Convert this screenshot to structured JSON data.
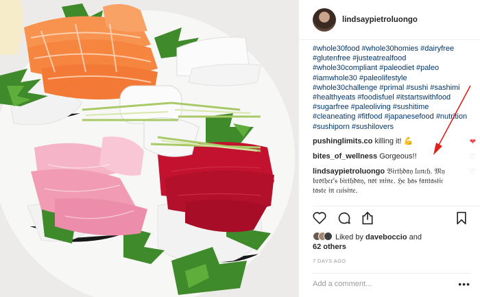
{
  "post": {
    "username": "lindsaypietroluongo",
    "caption": "#whole30food #whole30homies #dairyfree #glutenfree #justeatrealfood #whole30compliant #paleodiet #paleo #iamwhole30 #paleolifestyle #whole30challenge #primal #sushi #sashimi #healthyeats #foodisfuel #itstartswithfood #sugarfree #paleoliving #sushitime #cleaneating #fitfood #japanesefood #nutrition #sushiporn #sushilovers"
  },
  "comments": [
    {
      "user": "pushinglimits.co",
      "text": "killing it! 💪",
      "liked": true
    },
    {
      "user": "bites_of_wellness",
      "text": "Gorgeous!!",
      "liked": false
    },
    {
      "user": "lindsaypietroluongo",
      "text": "𝔅𝔦𝔯𝔱𝔥𝔡𝔞𝔶 𝔩𝔲𝔫𝔠𝔥. 𝔐𝔶 𝔟𝔯𝔬𝔱𝔥𝔢𝔯'𝔰 𝔟𝔦𝔯𝔱𝔥𝔡𝔞𝔶, 𝔫𝔬𝔱 𝔪𝔦𝔫𝔢. ℌ𝔢 𝔥𝔞𝔰 𝔣𝔞𝔫𝔱𝔞𝔰𝔱𝔦𝔠 𝔱𝔞𝔰𝔱𝔢 𝔦𝔫 𝔠𝔲𝔦𝔰𝔦𝔫𝔢.",
      "liked": false
    }
  ],
  "likes": {
    "prefix": "Liked by",
    "user": "daveboccio",
    "conj": "and",
    "others": "62 others"
  },
  "time": "7 DAYS AGO",
  "add_comment": {
    "placeholder": "Add a comment...",
    "more": "•••"
  },
  "icons": [
    "heart-icon",
    "comment-icon",
    "share-icon",
    "bookmark-icon",
    "more-options-icon"
  ],
  "colors": {
    "link": "#003569",
    "liked_heart": "#ed4956",
    "arrow": "#e0201b"
  }
}
